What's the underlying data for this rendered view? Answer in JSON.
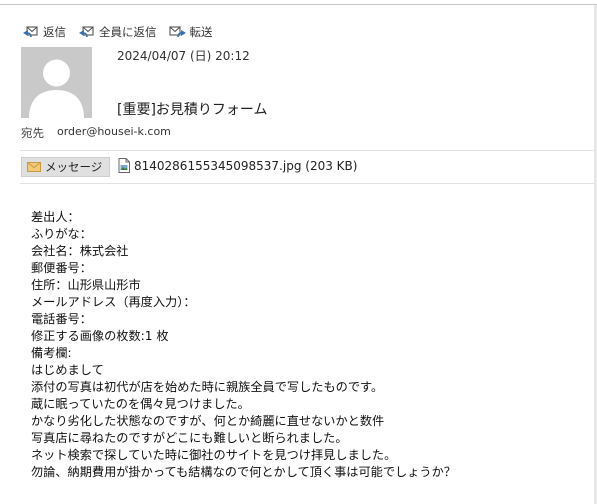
{
  "toolbar": {
    "reply_label": "返信",
    "reply_all_label": "全員に返信",
    "forward_label": "転送"
  },
  "header": {
    "date": "2024/04/07 (日) 20:12",
    "subject": "[重要]お見積りフォーム",
    "to_label": "宛先",
    "to_value": "order@housei-k.com"
  },
  "tabs": {
    "message_label": "メッセージ",
    "attachment_label": "8140286155345098537.jpg (203 KB)"
  },
  "body_lines": [
    "差出人：",
    "ふりがな：",
    "会社名：株式会社",
    "郵便番号：",
    "住所：山形県山形市",
    "メールアドレス（再度入力）：",
    "電話番号：",
    "修正する画像の枚数:1 枚",
    "備考欄:",
    "はじめまして",
    "添付の写真は初代が店を始めた時に親族全員で写したものです。",
    "蔵に眠っていたのを偶々見つけました。",
    "かなり劣化した状態なのですが、何とか綺麗に直せないかと数件",
    "写真店に尋ねたのですがどこにも難しいと断られました。",
    "ネット検索で探していた時に御社のサイトを見つけ拝見しました。",
    "勿論、納期費用が掛かっても結構なので何とかして頂く事は可能でしょうか？"
  ]
}
